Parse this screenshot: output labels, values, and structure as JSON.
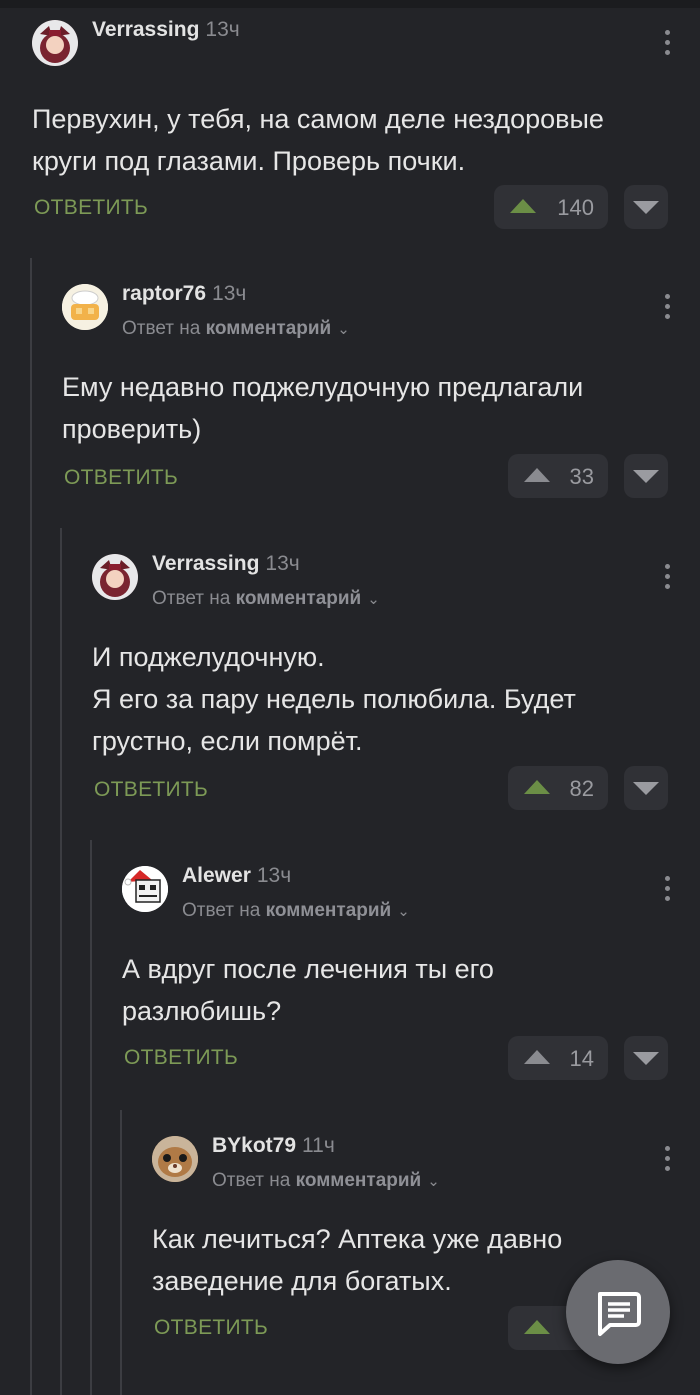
{
  "comments": [
    {
      "username": "Verrassing",
      "time": "13ч",
      "reply_prefix": "",
      "reply_target": "",
      "text": [
        "Первухин, у тебя, на самом деле нездоровые",
        "круги под глазами. Проверь почки."
      ],
      "reply_label": "ОТВЕТИТЬ",
      "votes": "140",
      "upvoted": true
    },
    {
      "username": "raptor76",
      "time": "13ч",
      "reply_prefix": "Ответ на",
      "reply_target": "комментарий",
      "text": [
        "Ему недавно поджелудочную предлагали",
        "проверить)"
      ],
      "reply_label": "ОТВЕТИТЬ",
      "votes": "33",
      "upvoted": false
    },
    {
      "username": "Verrassing",
      "time": "13ч",
      "reply_prefix": "Ответ на",
      "reply_target": "комментарий",
      "text": [
        "И поджелудочную.",
        "Я его за пару недель полюбила. Будет",
        "грустно, если помрёт."
      ],
      "reply_label": "ОТВЕТИТЬ",
      "votes": "82",
      "upvoted": true
    },
    {
      "username": "Alewer",
      "time": "13ч",
      "reply_prefix": "Ответ на",
      "reply_target": "комментарий",
      "text": [
        "А вдруг после лечения ты его",
        "разлюбишь?"
      ],
      "reply_label": "ОТВЕТИТЬ",
      "votes": "14",
      "upvoted": false
    },
    {
      "username": "BYkot79",
      "time": "11ч",
      "reply_prefix": "Ответ на",
      "reply_target": "комментарий",
      "text": [
        "Как лечиться? Аптека уже давно",
        "заведение для богатых."
      ],
      "reply_label": "ОТВЕТИТЬ",
      "votes": "",
      "upvoted": true
    }
  ],
  "icons": {
    "menu": "more-vertical-icon",
    "upvote": "upvote-icon",
    "downvote": "downvote-icon",
    "chevron": "chevron-down-icon",
    "fab": "comment-icon"
  },
  "colors": {
    "background": "#232428",
    "accent_green": "#7d9a56",
    "vote_bg": "#303136"
  }
}
